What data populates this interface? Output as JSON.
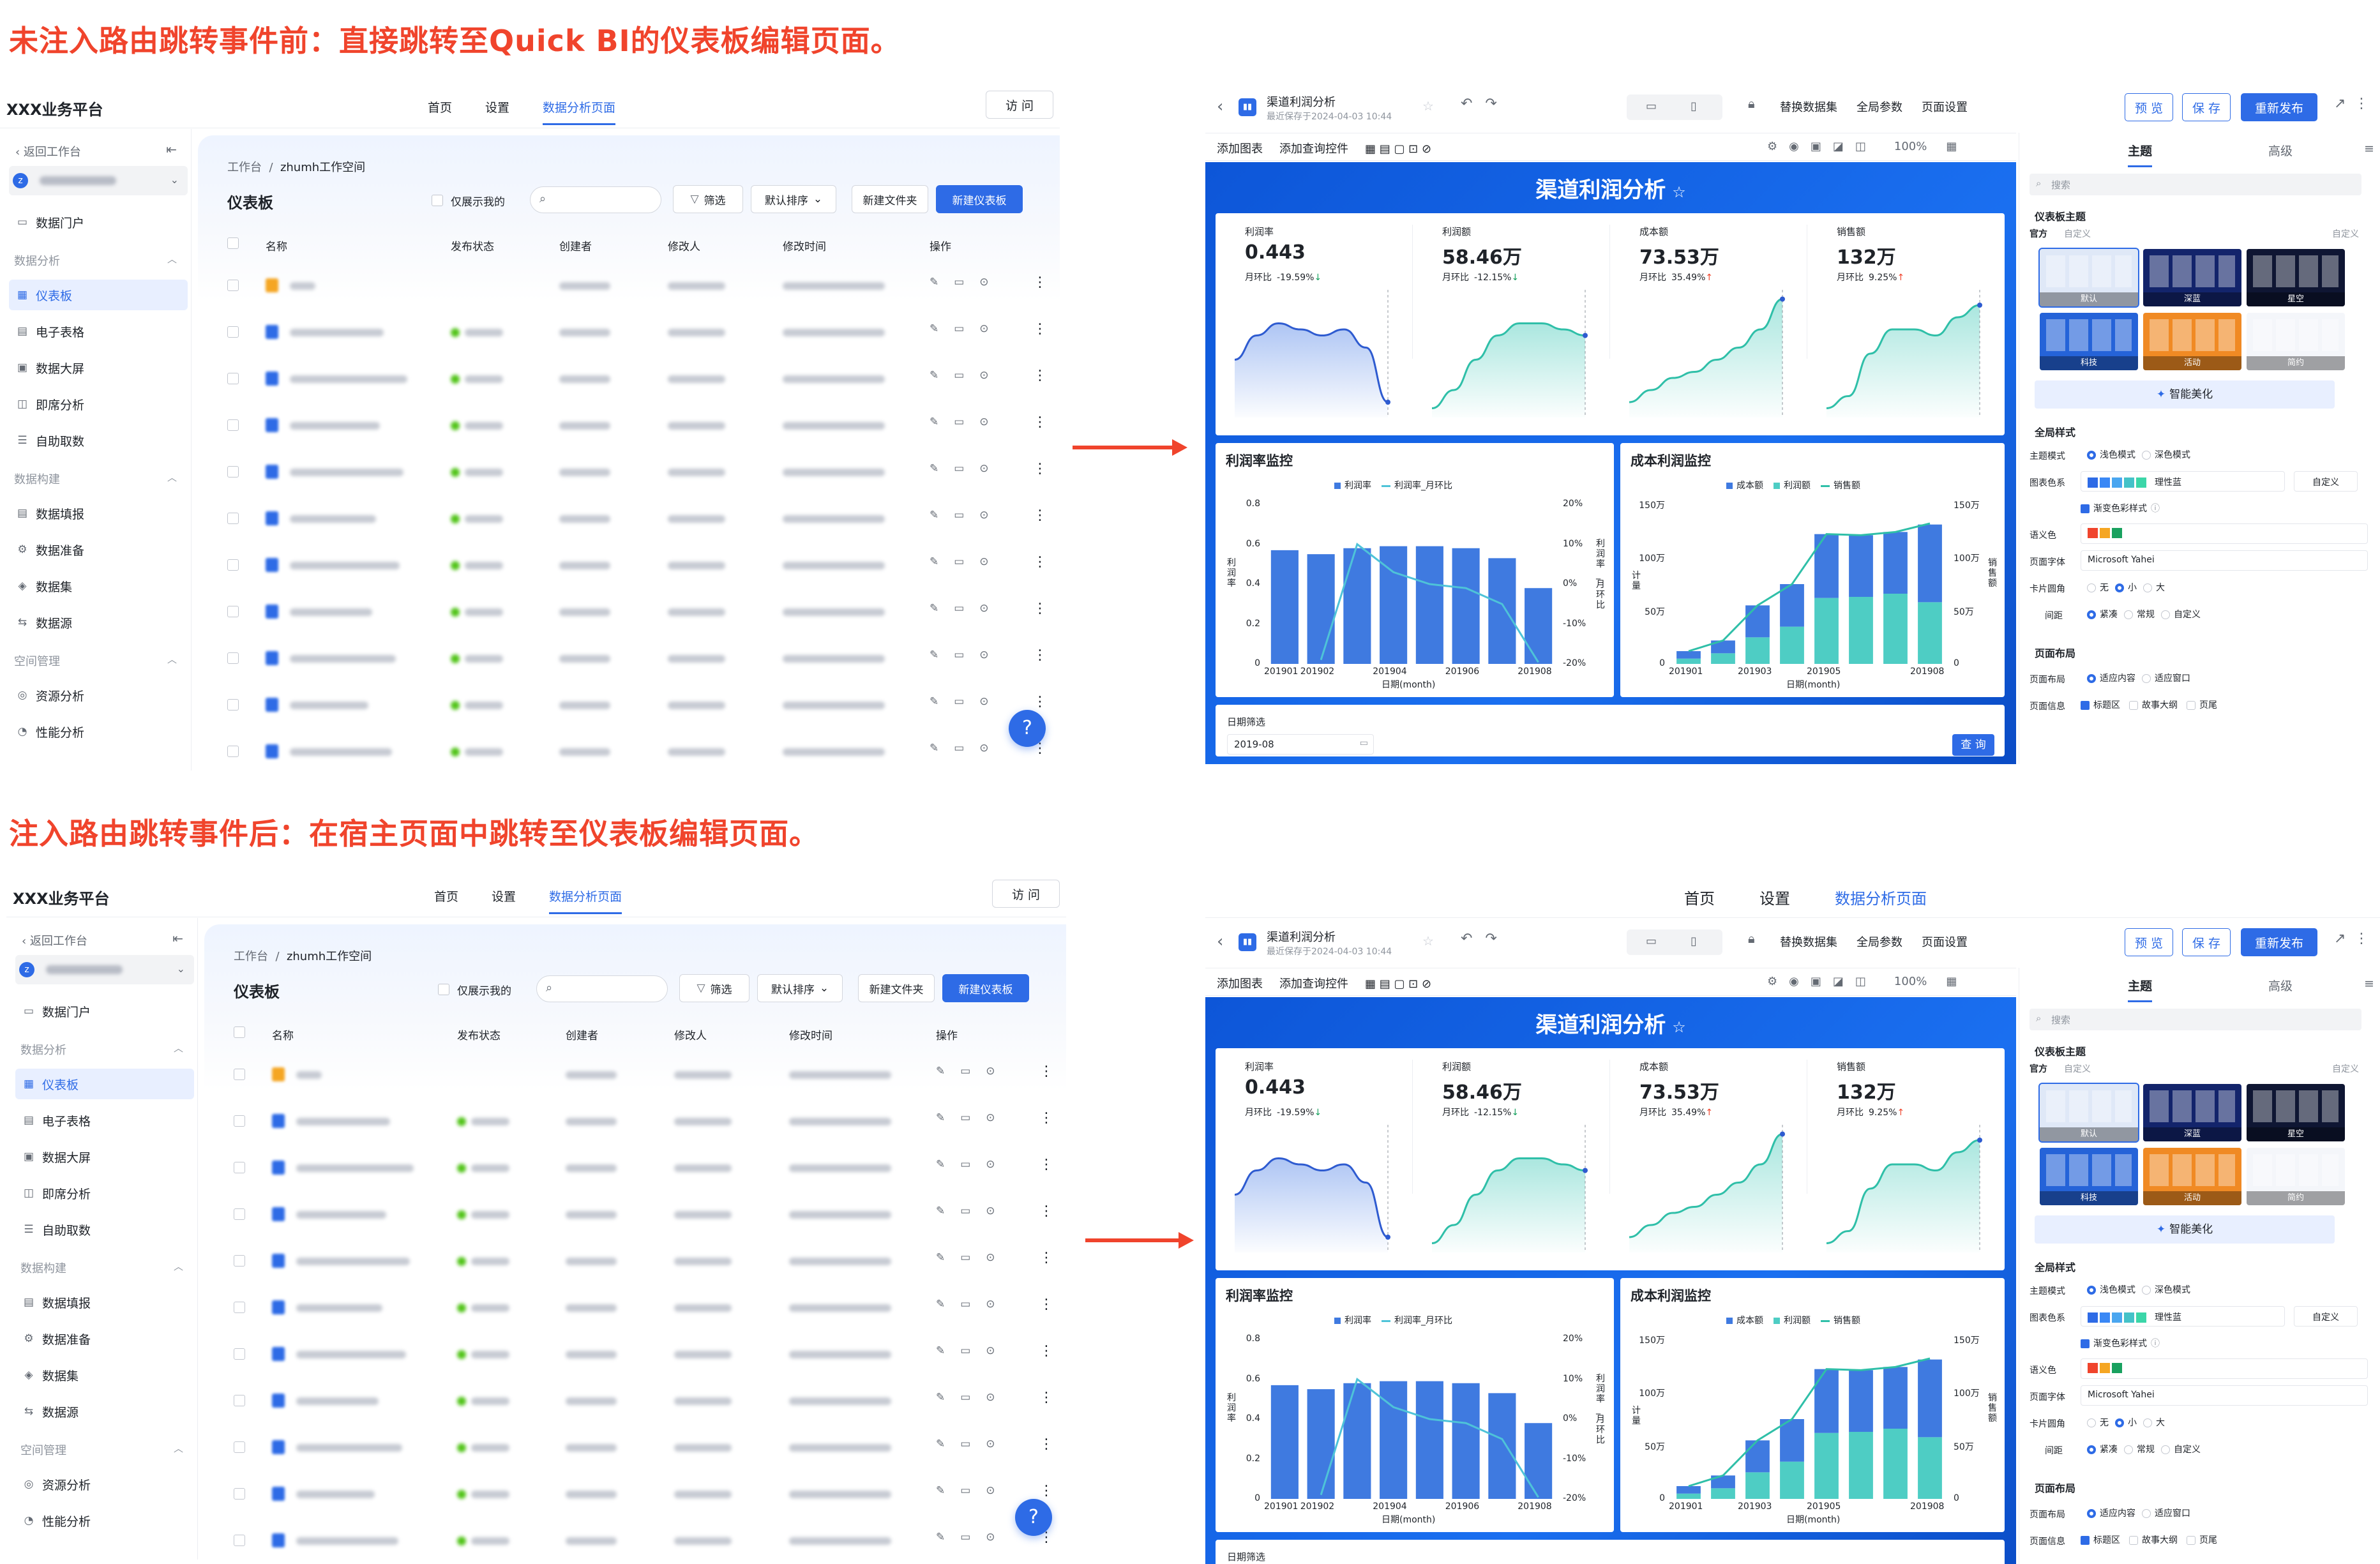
{
  "captions": {
    "before": "未注入路由跳转事件前：直接跳转至Quick BI的仪表板编辑页面。",
    "after": "注入路由跳转事件后：在宿主页面中跳转至仪表板编辑页面。"
  },
  "host": {
    "brand": "XXX业务平台",
    "nav": [
      "首页",
      "设置",
      "数据分析页面"
    ],
    "active_nav": "数据分析页面",
    "visit_label": "访 问",
    "back_label": "返回工作台",
    "user_avatar": "z",
    "sidebar": [
      {
        "type": "item",
        "label": "数据门户",
        "icon": "portal-icon"
      },
      {
        "type": "group",
        "label": "数据分析"
      },
      {
        "type": "item",
        "label": "仪表板",
        "icon": "dashboard-icon",
        "active": true
      },
      {
        "type": "item",
        "label": "电子表格",
        "icon": "spreadsheet-icon"
      },
      {
        "type": "item",
        "label": "数据大屏",
        "icon": "screen-icon"
      },
      {
        "type": "item",
        "label": "即席分析",
        "icon": "adhoc-icon"
      },
      {
        "type": "item",
        "label": "自助取数",
        "icon": "fetch-icon"
      },
      {
        "type": "group",
        "label": "数据构建"
      },
      {
        "type": "item",
        "label": "数据填报",
        "icon": "form-icon"
      },
      {
        "type": "item",
        "label": "数据准备",
        "icon": "prep-icon"
      },
      {
        "type": "item",
        "label": "数据集",
        "icon": "dataset-icon"
      },
      {
        "type": "item",
        "label": "数据源",
        "icon": "datasource-icon"
      },
      {
        "type": "group",
        "label": "空间管理"
      },
      {
        "type": "item",
        "label": "资源分析",
        "icon": "resource-icon"
      },
      {
        "type": "item",
        "label": "性能分析",
        "icon": "perf-icon"
      }
    ],
    "breadcrumb": [
      "工作台",
      "zhumh工作空间"
    ],
    "page_title": "仪表板",
    "only_mine": "仅展示我的",
    "filter_btn": "筛选",
    "sort_btn": "默认排序",
    "new_folder_btn": "新建文件夹",
    "new_dashboard_btn": "新建仪表板",
    "columns": [
      "名称",
      "发布状态",
      "创建者",
      "修改人",
      "修改时间",
      "操作"
    ],
    "row_count": 11,
    "help_icon": "?"
  },
  "editor": {
    "host_nav": [
      "首页",
      "设置",
      "数据分析页面"
    ],
    "name": "渠道利润分析",
    "saved": "最近保存于2024-04-03 10:44",
    "tools": [
      "替换数据集",
      "全局参数",
      "页面设置"
    ],
    "preview": "预 览",
    "save": "保 存",
    "publish_before": "重新发布",
    "publish_after": "重新发布",
    "bar2_left": [
      "添加图表",
      "添加查询控件"
    ],
    "zoom": "100%",
    "canvas_title": "渠道利润分析",
    "kpis": [
      {
        "label": "利润率",
        "value": "0.443",
        "mom_label": "月环比",
        "mom": "-19.59%",
        "dir": "down",
        "curve": [
          0.55,
          0.35,
          0.25,
          0.3,
          0.35,
          0.3,
          0.45,
          0.9
        ]
      },
      {
        "label": "利润额",
        "value": "58.46万",
        "mom_label": "月环比",
        "mom": "-12.15%",
        "dir": "down",
        "curve": [
          0.95,
          0.8,
          0.55,
          0.35,
          0.25,
          0.25,
          0.3,
          0.35
        ]
      },
      {
        "label": "成本额",
        "value": "73.53万",
        "mom_label": "月环比",
        "mom": "35.49%",
        "dir": "up",
        "curve": [
          0.9,
          0.8,
          0.7,
          0.65,
          0.55,
          0.45,
          0.3,
          0.05
        ]
      },
      {
        "label": "销售额",
        "value": "132万",
        "mom_label": "月环比",
        "mom": "9.25%",
        "dir": "up",
        "curve": [
          0.95,
          0.85,
          0.5,
          0.3,
          0.3,
          0.35,
          0.2,
          0.1
        ]
      }
    ],
    "chart1": {
      "title": "利润率监控",
      "legend": [
        "利润率",
        "利润率_月环比"
      ],
      "y_left_label": "利润率",
      "y_right_label": "利润率_月环比",
      "y_left_ticks": [
        "0.8",
        "0.6",
        "0.4",
        "0.2",
        "0"
      ],
      "y_right_ticks": [
        "20%",
        "10%",
        "0%",
        "-10%",
        "-20%"
      ],
      "x_ticks": [
        "201901",
        "201902",
        "",
        "201904",
        "",
        "201906",
        "",
        "201908"
      ],
      "x_title": "日期(month)"
    },
    "chart2": {
      "title": "成本利润监控",
      "legend": [
        "成本额",
        "利润额",
        "销售额"
      ],
      "y_left_label": "计量",
      "y_right_label": "销售额",
      "y_left_ticks": [
        "150万",
        "100万",
        "50万",
        "0"
      ],
      "y_right_ticks": [
        "150万",
        "100万",
        "50万",
        "0"
      ],
      "x_ticks": [
        "201901",
        "",
        "201903",
        "",
        "201905",
        "",
        "",
        "201908"
      ],
      "x_title": "日期(month)"
    },
    "filter_label": "日期筛选",
    "filter_value": "2019-08",
    "query_btn": "查 询",
    "panel": {
      "tabs": [
        "主题",
        "高级"
      ],
      "search_placeholder": "搜索",
      "theme_section": "仪表板主题",
      "theme_tabs": [
        "官方",
        "自定义"
      ],
      "themes": [
        {
          "name": "默认",
          "color": "#dfe8f7"
        },
        {
          "name": "深蓝",
          "color": "#13246b"
        },
        {
          "name": "星空",
          "color": "#0f1633"
        },
        {
          "name": "科技",
          "color": "#2563d8"
        },
        {
          "name": "活动",
          "color": "#f08a24"
        },
        {
          "name": "简约",
          "color": "#f4f6fa"
        }
      ],
      "beautify": "智能美化",
      "global_section": "全局样式",
      "theme_mode_label": "主题模式",
      "theme_mode_opts": [
        "浅色模式",
        "深色模式"
      ],
      "palette_label": "图表色系",
      "palette_name": "理性蓝",
      "palette_colors": [
        "#2e6be6",
        "#3a88f5",
        "#4aa6f0",
        "#44c2c8",
        "#3bd6a8"
      ],
      "custom": "自定义",
      "gradient_label": "渐变色彩样式",
      "semantic_label": "语义色",
      "semantic_colors": [
        "#f0442c",
        "#f5a623",
        "#19a15f"
      ],
      "font_label": "页面字体",
      "font_value": "Microsoft Yahei",
      "radius_label": "卡片圆角",
      "radius_opts": [
        "无",
        "小",
        "大"
      ],
      "gap_label": "间距",
      "gap_opts": [
        "紧凑",
        "常规",
        "自定义"
      ],
      "layout_section": "页面布局",
      "layout_label": "页面布局",
      "layout_opts": [
        "适应内容",
        "适应窗口"
      ],
      "info_label": "页面信息",
      "info_opts": [
        "标题区",
        "故事大纲",
        "页尾"
      ]
    }
  },
  "chart_data": [
    {
      "type": "bar",
      "title": "利润率监控",
      "categories": [
        "201901",
        "201902",
        "201903",
        "201904",
        "201905",
        "201906",
        "201907",
        "201908"
      ],
      "series": [
        {
          "name": "利润率",
          "type": "bar",
          "values": [
            0.57,
            0.55,
            0.58,
            0.59,
            0.59,
            0.58,
            0.53,
            0.38
          ]
        },
        {
          "name": "利润率_月环比",
          "type": "line",
          "axis": "right",
          "values": [
            null,
            -19,
            10,
            3,
            0,
            -1,
            -5,
            -19.59
          ]
        }
      ],
      "ylim_left": [
        0,
        0.8
      ],
      "ylim_right": [
        -20,
        20
      ],
      "xlabel": "日期(month)",
      "ylabel": "利润率"
    },
    {
      "type": "bar",
      "title": "成本利润监控",
      "categories": [
        "201901",
        "201902",
        "201903",
        "201904",
        "201905",
        "201906",
        "201907",
        "201908"
      ],
      "series": [
        {
          "name": "成本额",
          "type": "stacked_bar",
          "values": [
            7,
            12,
            30,
            40,
            60,
            58,
            58,
            73
          ]
        },
        {
          "name": "利润额",
          "type": "stacked_bar",
          "values": [
            5,
            10,
            25,
            35,
            62,
            63,
            66,
            58
          ]
        },
        {
          "name": "销售额",
          "type": "line",
          "axis": "right",
          "values": [
            12,
            22,
            55,
            75,
            122,
            121,
            124,
            132
          ]
        }
      ],
      "ylim": [
        0,
        150
      ],
      "unit": "万",
      "xlabel": "日期(month)",
      "ylabel": "计量"
    }
  ],
  "colors": {
    "accent": "#2e6be6",
    "caption": "#f0442c",
    "bar": "#3f7ae0",
    "bar2": "#4ecdc4"
  }
}
